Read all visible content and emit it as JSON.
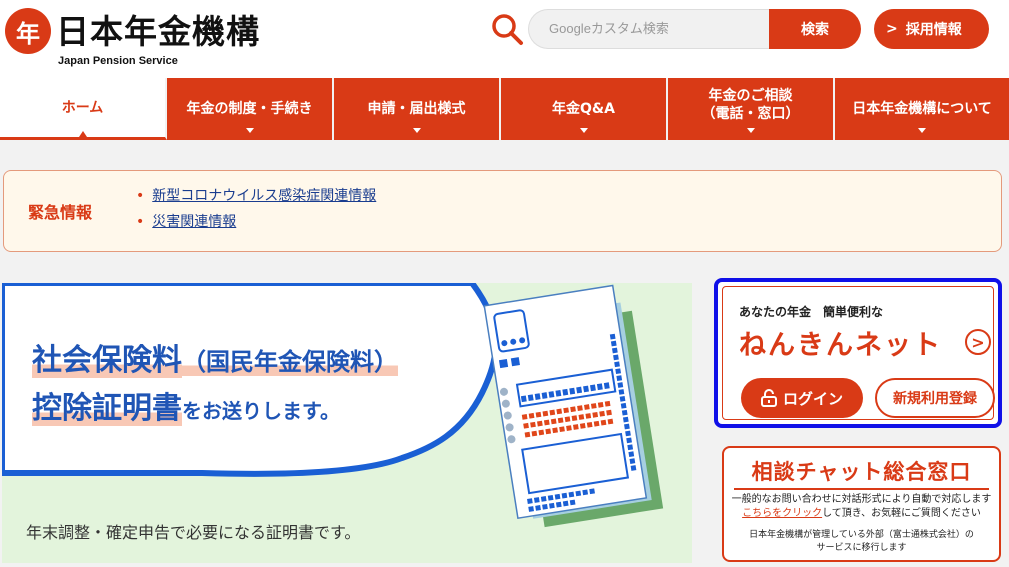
{
  "header": {
    "logo_mark": "年",
    "logo_title": "日本年金機構",
    "logo_sub": "Japan Pension Service",
    "search_placeholder": "Googleカスタム検索",
    "search_button": "検索",
    "recruit_chevron": ">",
    "recruit_label": "採用情報"
  },
  "nav": {
    "items": [
      {
        "label": "ホーム"
      },
      {
        "label": "年金の制度・手続き"
      },
      {
        "label": "申請・届出様式"
      },
      {
        "label": "年金Q&A"
      },
      {
        "label_line1": "年金のご相談",
        "label_line2": "（電話・窓口）"
      },
      {
        "label": "日本年金機構について"
      }
    ]
  },
  "alert": {
    "title": "緊急情報",
    "bullet": "•",
    "links": [
      "新型コロナウイルス感染症関連情報",
      "災害関連情報"
    ]
  },
  "banner": {
    "line1_main": "社会保険料",
    "line1_paren": "（国民年金保険料）",
    "line2_main": "控除証明書",
    "line2_rest": "をお送りします。",
    "footer": "年末調整・確定申告で必要になる証明書です。"
  },
  "nenkin_net": {
    "subtitle": "あなたの年金　簡単便利な",
    "title": "ねんきんネット",
    "arrow": ">",
    "login": "ログイン",
    "register": "新規利用登録"
  },
  "chat": {
    "title": "相談チャット総合窓口",
    "line1": "一般的なお問い合わせに対話形式により自動で対応します",
    "link": "こちらをクリック",
    "line2_rest": "して頂き、お気軽にご質問ください",
    "note1": "日本年金機構が管理している外部（富士通株式会社）の",
    "note2": "サービスに移行します"
  },
  "colors": {
    "brand_red": "#d93a16",
    "nav_text": "#ffffff",
    "banner_blue": "#1f55b5",
    "banner_bg": "#e3f4dc",
    "highlight_border": "#1010e8"
  }
}
